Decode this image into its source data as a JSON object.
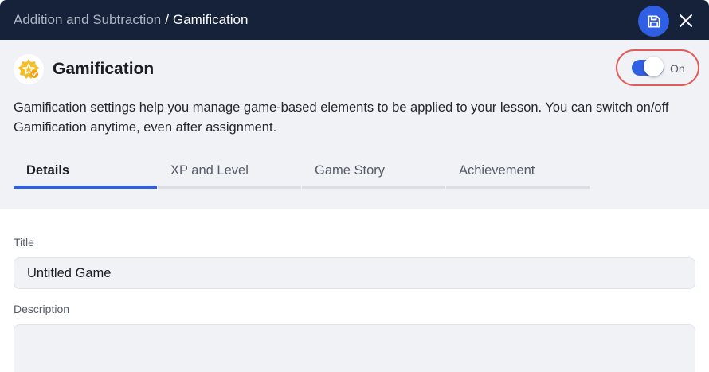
{
  "header": {
    "breadcrumb_parent": "Addition and Subtraction",
    "breadcrumb_separator": "/",
    "breadcrumb_current": "Gamification",
    "save_icon": "save-icon",
    "close_icon": "close-icon"
  },
  "gamification": {
    "logo_icon": "gamification-badge-icon",
    "title": "Gamification",
    "toggle_state": "On",
    "description": "Gamification settings help you manage game-based elements to be applied to your lesson. You can switch on/off Gamification anytime, even after assignment."
  },
  "tabs": [
    {
      "label": "Details",
      "active": true
    },
    {
      "label": "XP and Level",
      "active": false
    },
    {
      "label": "Game Story",
      "active": false
    },
    {
      "label": "Achievement",
      "active": false
    }
  ],
  "form": {
    "title_label": "Title",
    "title_value": "Untitled Game",
    "description_label": "Description",
    "description_value": ""
  },
  "colors": {
    "header_bg": "#16213a",
    "accent": "#2f5fe3",
    "highlight": "#e35b5b",
    "panel_bg": "#f1f2f6"
  }
}
